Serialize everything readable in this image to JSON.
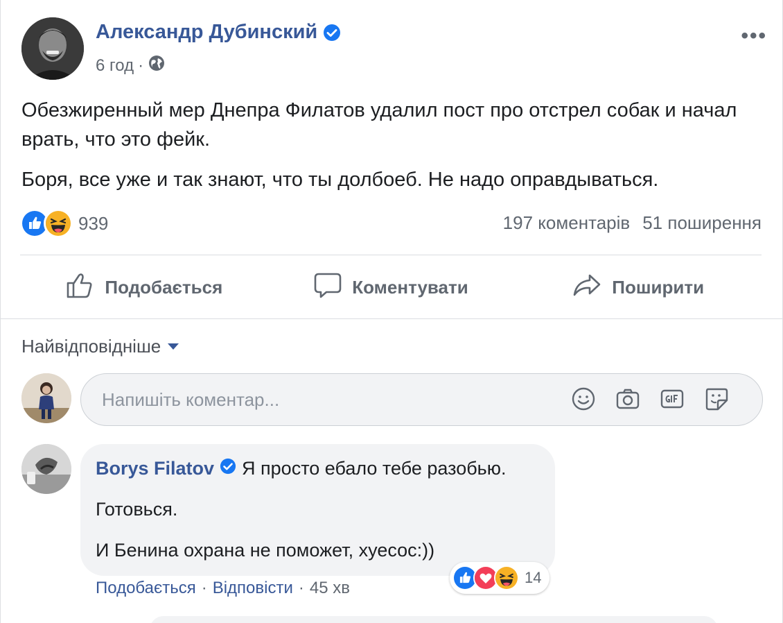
{
  "post": {
    "author": "Александр Дубинский",
    "time": "6 год",
    "meta_dot": "·",
    "more": "•••",
    "paragraphs": [
      "Обезжиренный мер Днепра Филатов удалил пост про отстрел собак и начал врать, что это фейк.",
      "Боря, все уже и так знают, что ты долбоеб. Не надо оправдываться."
    ],
    "reaction_count": "939",
    "comments_count": "197 коментарів",
    "shares_count": "51 поширення"
  },
  "actions": {
    "like": "Подобається",
    "comment": "Коментувати",
    "share": "Поширити"
  },
  "comments": {
    "sort_label": "Найвідповідніше",
    "input_placeholder": "Напишіть коментар...",
    "items": [
      {
        "author": "Borys Filatov",
        "line1": "Я просто ебало тебе разобью.",
        "line2": "Готовься.",
        "line3": "И Бенина охрана не поможет, хуесос:))",
        "reaction_count": "14",
        "like_label": "Подобається",
        "reply_label": "Відповісти",
        "time": "45 хв",
        "dot": "·"
      }
    ]
  },
  "colors": {
    "link": "#385898",
    "secondary": "#606770",
    "like_blue": "#1877f2",
    "love_red": "#f33e58",
    "haha_yellow": "#f7b125"
  }
}
